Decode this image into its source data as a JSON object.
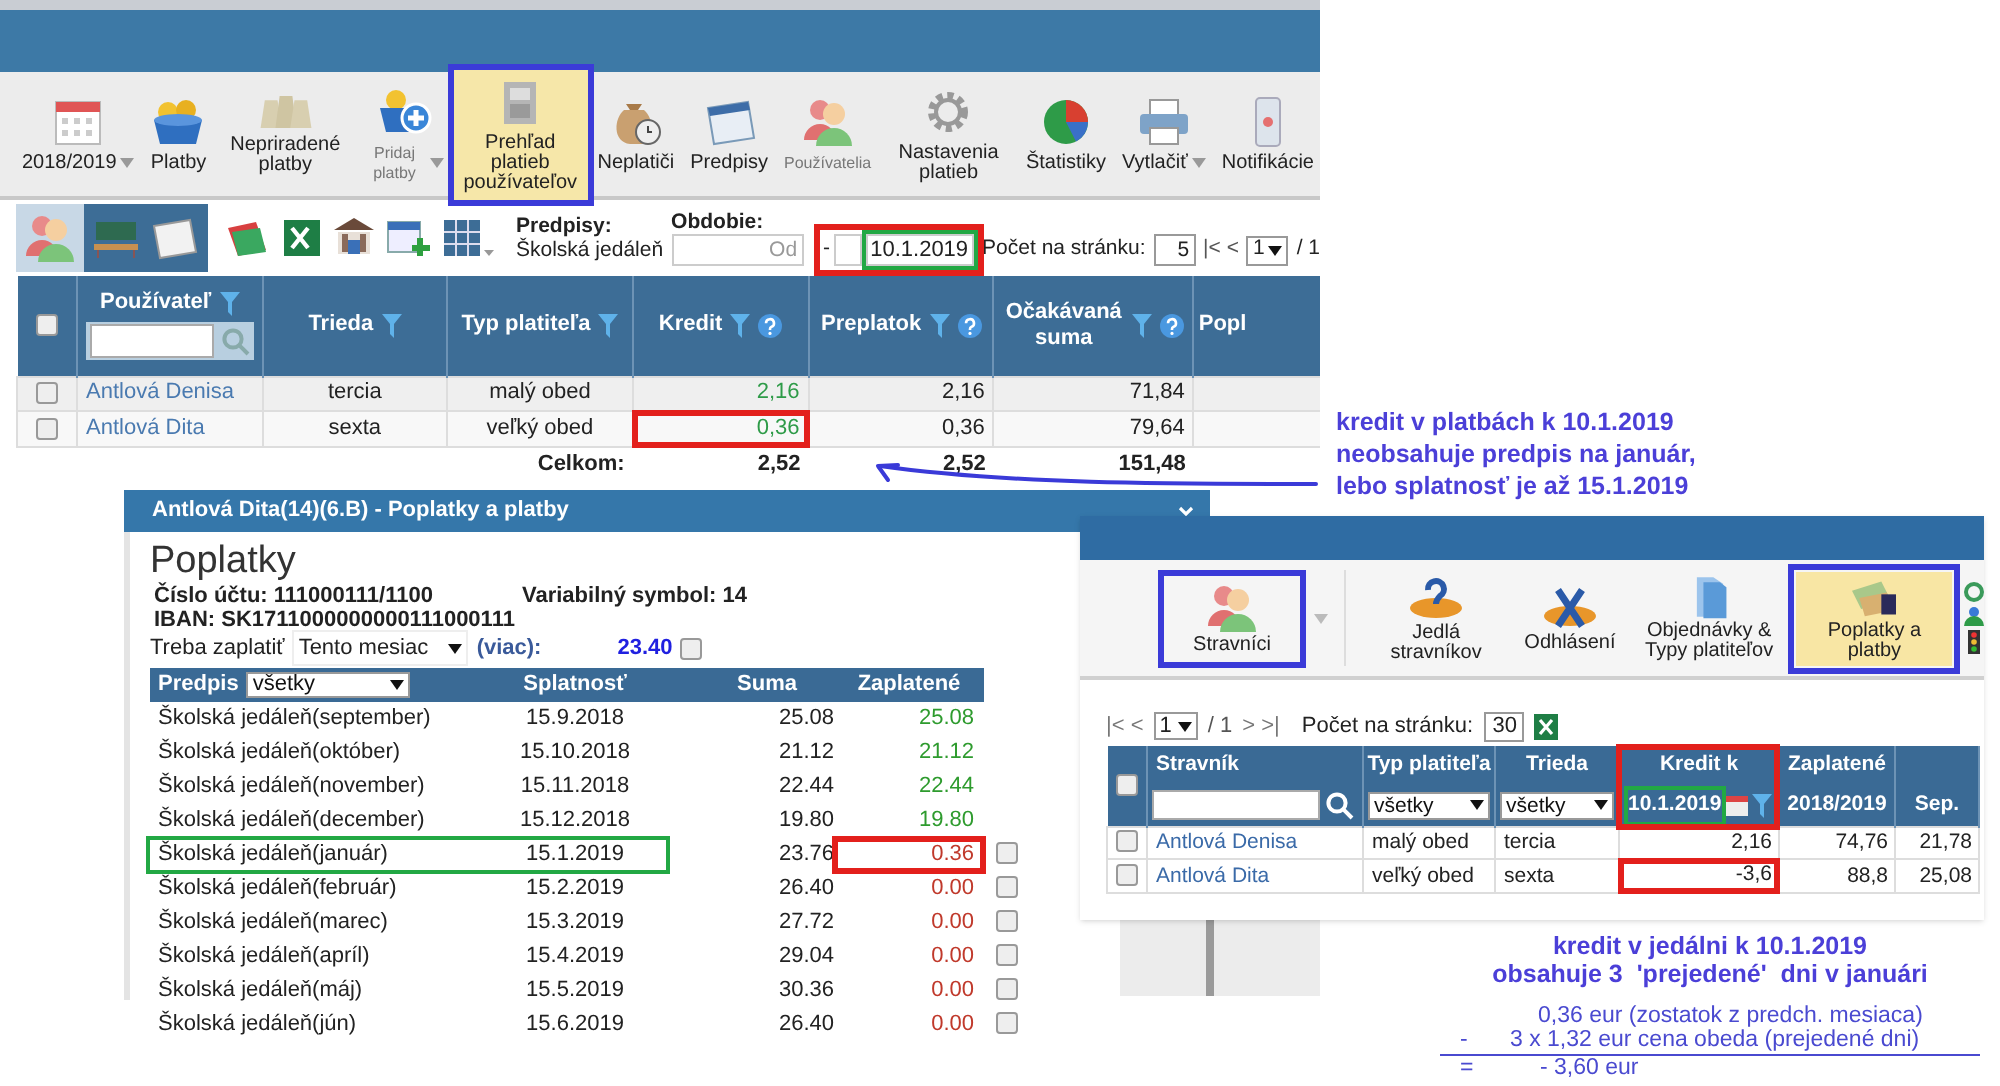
{
  "main_window": {
    "toolbar": [
      {
        "label": "2018/2019",
        "selected": false,
        "dropdown": true,
        "dimmed": false
      },
      {
        "label": "Platby",
        "selected": false,
        "dropdown": false,
        "dimmed": false
      },
      {
        "label": "Nepriradené platby",
        "selected": false,
        "dropdown": false,
        "dimmed": false
      },
      {
        "label": "Pridaj platby",
        "selected": false,
        "dropdown": true,
        "dimmed": true
      },
      {
        "label": "Prehľad platieb používateľov",
        "selected": true,
        "dropdown": false,
        "dimmed": false
      },
      {
        "label": "Neplatiči",
        "selected": false,
        "dropdown": false,
        "dimmed": false
      },
      {
        "label": "Predpisy",
        "selected": false,
        "dropdown": false,
        "dimmed": false
      },
      {
        "label": "Používatelia",
        "selected": false,
        "dropdown": false,
        "dimmed": true
      },
      {
        "label": "Nastavenia platieb",
        "selected": false,
        "dropdown": false,
        "dimmed": false
      },
      {
        "label": "Štatistiky",
        "selected": false,
        "dropdown": false,
        "dimmed": false
      },
      {
        "label": "Vytlačiť",
        "selected": false,
        "dropdown": true,
        "dimmed": false
      },
      {
        "label": "Notifikácie",
        "selected": false,
        "dropdown": false,
        "dimmed": false
      }
    ],
    "filters": {
      "prescriptions_label": "Predpisy:",
      "prescriptions_value": "Školská jedáleň",
      "period_label": "Obdobie:",
      "from_placeholder": "Od",
      "separator": "-",
      "to_value": "10.1.2019",
      "per_page_label": "Počet na stránku:",
      "per_page": "5",
      "pager_nav": "|< <",
      "page": "1",
      "page_total": "/ 1"
    },
    "table": {
      "select_all_checked": false,
      "columns": [
        "Používateľ",
        "Trieda",
        "Typ platiteľa",
        "Kredit",
        "Preplatok",
        "Očakávaná suma",
        "Popl"
      ],
      "rows": [
        {
          "checked": false,
          "cells": [
            "Antlová Denisa",
            "tercia",
            "malý obed",
            "2,16",
            "2,16",
            "71,84"
          ]
        },
        {
          "checked": false,
          "cells": [
            "Antlová Dita",
            "sexta",
            "veľký obed",
            "0,36",
            "0,36",
            "79,64"
          ]
        }
      ],
      "total": {
        "label": "Celkom:",
        "values": [
          "2,52",
          "2,52",
          "151,48"
        ]
      }
    }
  },
  "note_payments": [
    "kredit v platbách k 10.1.2019",
    "neobsahuje predpis na január,",
    "lebo splatnosť je až 15.1.2019"
  ],
  "fees_dialog": {
    "title": "Antlová Dita(14)(6.B) - Poplatky a platby",
    "heading": "Poplatky",
    "account": "Číslo účtu: 111000111/1100",
    "variable_symbol": "Variabilný symbol: 14",
    "iban": "IBAN: SK1711000000000111000111",
    "due_label": "Treba zaplatiť",
    "due_period": "Tento mesiac",
    "more_link": "(viac):",
    "due_amount": "23.40",
    "due_checked": false,
    "table": {
      "columns": [
        "Predpis",
        "Splatnosť",
        "Suma",
        "Zaplatené"
      ],
      "filter": "všetky",
      "rows": [
        {
          "name": "Školská jedáleň(september)",
          "due": "15.9.2018",
          "sum": "25.08",
          "paid_amount": "25.08",
          "paid": true
        },
        {
          "name": "Školská jedáleň(október)",
          "due": "15.10.2018",
          "sum": "21.12",
          "paid_amount": "21.12",
          "paid": true
        },
        {
          "name": "Školská jedáleň(november)",
          "due": "15.11.2018",
          "sum": "22.44",
          "paid_amount": "22.44",
          "paid": true
        },
        {
          "name": "Školská jedáleň(december)",
          "due": "15.12.2018",
          "sum": "19.80",
          "paid_amount": "19.80",
          "paid": true
        },
        {
          "name": "Školská jedáleň(január)",
          "due": "15.1.2019",
          "sum": "23.76",
          "paid_amount": "0.36",
          "paid": false,
          "checked": false
        },
        {
          "name": "Školská jedáleň(február)",
          "due": "15.2.2019",
          "sum": "26.40",
          "paid_amount": "0.00",
          "paid": false,
          "checked": false
        },
        {
          "name": "Školská jedáleň(marec)",
          "due": "15.3.2019",
          "sum": "27.72",
          "paid_amount": "0.00",
          "paid": false,
          "checked": false
        },
        {
          "name": "Školská jedáleň(apríl)",
          "due": "15.4.2019",
          "sum": "29.04",
          "paid_amount": "0.00",
          "paid": false,
          "checked": false
        },
        {
          "name": "Školská jedáleň(máj)",
          "due": "15.5.2019",
          "sum": "30.36",
          "paid_amount": "0.00",
          "paid": false,
          "checked": false
        },
        {
          "name": "Školská jedáleň(jún)",
          "due": "15.6.2019",
          "sum": "26.40",
          "paid_amount": "0.00",
          "paid": false,
          "checked": false
        }
      ]
    }
  },
  "canteen_window": {
    "toolbar": [
      {
        "label": "Stravníci",
        "selected": false,
        "dropdown": true
      },
      {
        "label": "Jedlá stravníkov",
        "selected": false,
        "dropdown": false
      },
      {
        "label": "Odhlásení",
        "selected": false,
        "dropdown": false
      },
      {
        "label": "Objednávky & Typy platiteľov",
        "selected": false,
        "dropdown": false
      },
      {
        "label": "Poplatky a platby",
        "selected": true,
        "dropdown": false
      }
    ],
    "pager": {
      "first": "|< <",
      "page": "1",
      "page_total": "/ 1",
      "next": "> >|",
      "per_page_label": "Počet na stránku:",
      "per_page": "30"
    },
    "table": {
      "select_all_checked": false,
      "columns": [
        "Stravník",
        "Typ platiteľa",
        "Trieda",
        "Kredit k",
        "Zaplatené"
      ],
      "type_filter": "všetky",
      "class_filter": "všetky",
      "credit_date": "10.1.2019",
      "paid_subheaders": [
        "2018/2019",
        "Sep."
      ],
      "rows": [
        {
          "checked": false,
          "cells": [
            "Antlová Denisa",
            "malý obed",
            "tercia",
            "2,16",
            "74,76",
            "21,78"
          ]
        },
        {
          "checked": false,
          "cells": [
            "Antlová Dita",
            "veľký obed",
            "sexta",
            "-3,6",
            "88,8",
            "25,08"
          ]
        }
      ]
    }
  },
  "note_canteen": {
    "lines": [
      "kredit v jedálni k 10.1.2019",
      "obsahuje 3  'prejedené'  dni v januári"
    ],
    "calc": [
      {
        "text": "0,36 eur (zostatok z predch. mesiaca)"
      },
      {
        "op": "-",
        "text": "3 x 1,32 eur cena obeda (prejedené dni)"
      },
      {
        "op": "=",
        "text": "- 3,60 eur"
      }
    ]
  }
}
